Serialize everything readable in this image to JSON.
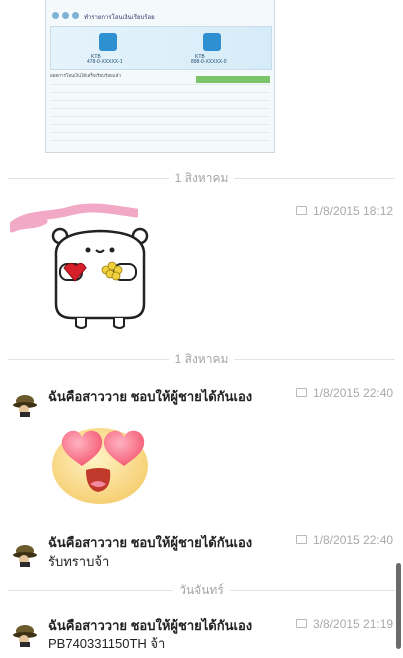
{
  "receipt": {
    "header": "ทำรายการโอนเงินเรียบร้อย",
    "account_from": "478-0-XXXXX-1",
    "account_to": "898-0-XXXXX-0",
    "bank_logo_text": "KTB",
    "note": "ยอดการโอนเงินได้เสร็จเรียบร้อยแล้ว"
  },
  "separators": [
    {
      "label": "1 สิงหาคม"
    },
    {
      "label": "1 สิงหาคม"
    },
    {
      "label": "วันจันทร์"
    }
  ],
  "messages": [
    {
      "sender": "",
      "time": "1/8/2015 18:12",
      "type": "sticker-bear"
    },
    {
      "sender": "ฉันคือสาววาย ชอบให้ผู้ชายได้กันเอง",
      "time": "1/8/2015 22:40",
      "type": "emoji-heart-eyes"
    },
    {
      "sender": "ฉันคือสาววาย ชอบให้ผู้ชายได้กันเอง",
      "time": "1/8/2015 22:40",
      "text": "รับทราบจ้า"
    },
    {
      "sender": "ฉันคือสาววาย ชอบให้ผู้ชายได้กันเอง",
      "time": "3/8/2015 21:19",
      "text": "PB740331150TH จ้า"
    }
  ],
  "colors": {
    "separator_text": "#a5a5a5",
    "timestamp": "#a9a9a9",
    "sender": "#222222",
    "pink_scribble": "#f2a9c6"
  },
  "icons": {
    "message_stamp": "chat-bubble-icon",
    "avatar": "hat-avatar-icon"
  }
}
